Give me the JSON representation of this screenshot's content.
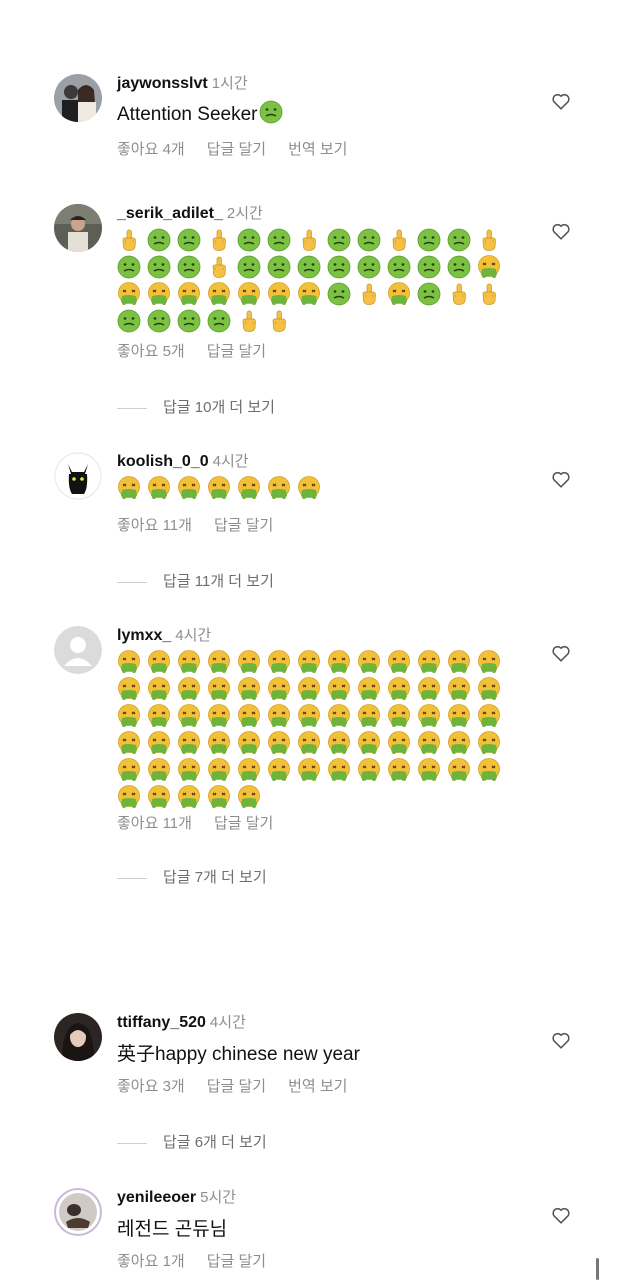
{
  "comments": [
    {
      "username": "jaywonsslvt",
      "time": "1시간",
      "text": "Attention Seeker",
      "text_trailing_emoji": "nauseated",
      "likes": "좋아요 4개",
      "reply": "답글 달기",
      "translate": "번역 보기"
    },
    {
      "username": "_serik_adilet_",
      "time": "2시간",
      "emoji_rows": [
        "FNNFNNFNNFNNF",
        "NNNFNNNNNNNNV",
        "VVVVVVVNFVNFF",
        "NNNNFF"
      ],
      "likes": "좋아요 5개",
      "reply": "답글 달기",
      "view_replies": "답글 10개 더 보기"
    },
    {
      "username": "koolish_0_0",
      "time": "4시간",
      "emoji_rows": [
        "VVVVVVV"
      ],
      "likes": "좋아요 11개",
      "reply": "답글 달기",
      "view_replies": "답글 11개 더 보기"
    },
    {
      "username": "lymxx_",
      "time": "4시간",
      "emoji_rows": [
        "VVVVVVVVVVVVV",
        "VVVVVVVVVVVVV",
        "VVVVVVVVVVVVV",
        "VVVVVVVVVVVVV",
        "VVVVVVVVVVVVV",
        "VVVVV"
      ],
      "likes": "좋아요 11개",
      "reply": "답글 달기",
      "view_replies": "답글 7개 더 보기"
    },
    {
      "username": "ttiffany_520",
      "time": "4시간",
      "text": "英子happy chinese new year",
      "likes": "좋아요 3개",
      "reply": "답글 달기",
      "translate": "번역 보기",
      "view_replies": "답글 6개 더 보기"
    },
    {
      "username": "yenileeoer",
      "time": "5시간",
      "text": "레전드 곤듀님",
      "likes": "좋아요 1개",
      "reply": "답글 달기"
    }
  ],
  "emoji_legend": {
    "F": "middle-finger",
    "N": "nauseated-face",
    "V": "vomiting-face"
  },
  "colors": {
    "secondary_text": "#8e8e8e",
    "emoji_yellow": "#f2c13a",
    "emoji_green": "#6fb43a",
    "story_ring": "#c9b9d9"
  }
}
